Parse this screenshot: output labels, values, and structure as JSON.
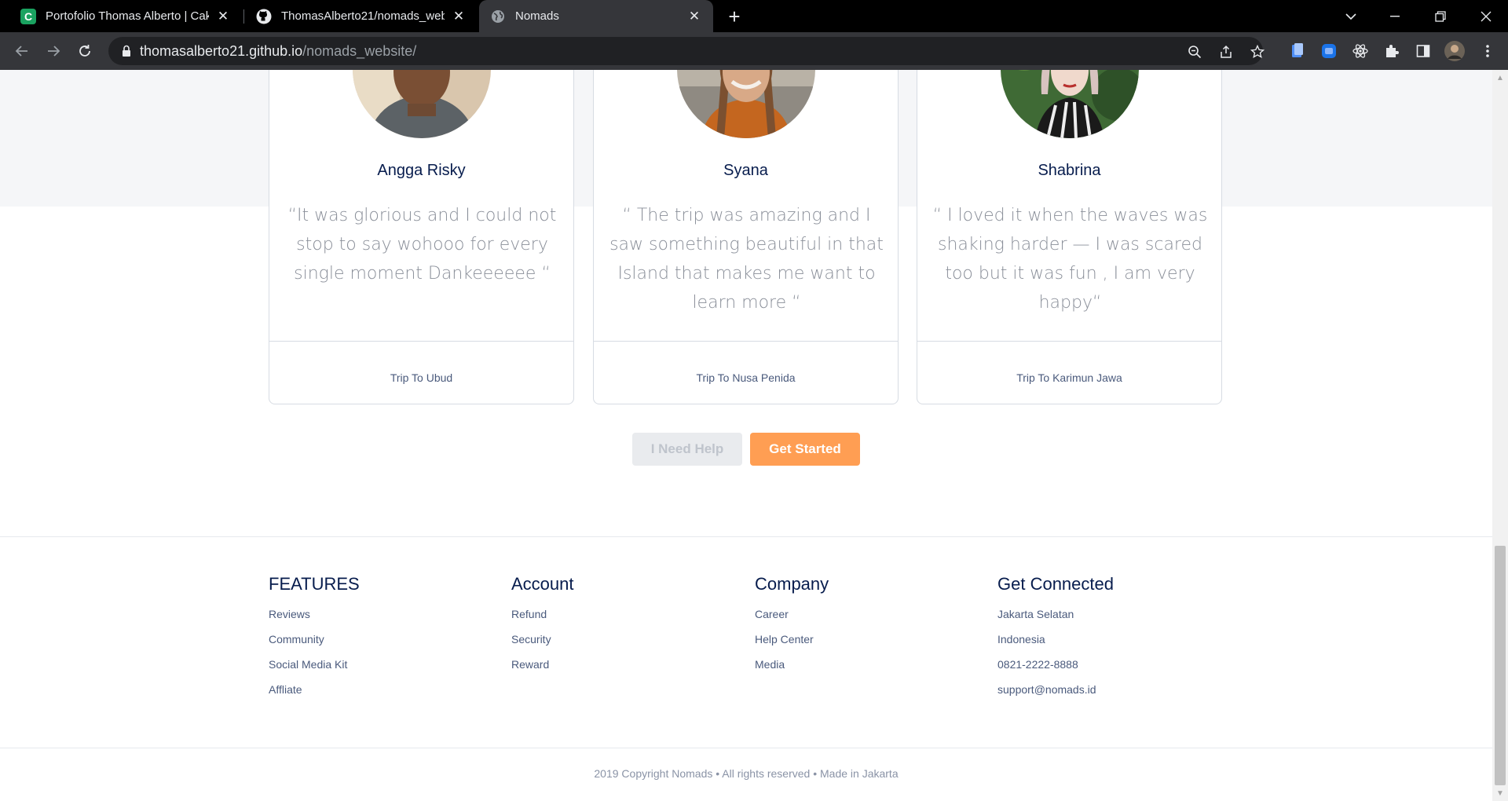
{
  "browser": {
    "tabs": [
      {
        "title": "Portofolio Thomas Alberto | Cake",
        "favicon": "cake-c-icon",
        "active": false
      },
      {
        "title": "ThomasAlberto21/nomads_webs",
        "favicon": "github-icon",
        "active": false
      },
      {
        "title": "Nomads",
        "favicon": "globe-icon",
        "active": true
      }
    ],
    "url_host": "thomasalberto21.github.io",
    "url_path": "/nomads_website/"
  },
  "testimonials": [
    {
      "name": "Angga Risky",
      "quote": "“It was glorious and I could not stop to say wohooo for every single moment Dankeeeeee “",
      "trip": "Trip To Ubud"
    },
    {
      "name": "Syana",
      "quote": "“ The trip was amazing and I saw something beautiful in that Island that makes me want to learn more “",
      "trip": "Trip To Nusa Penida"
    },
    {
      "name": "Shabrina",
      "quote": "“ I loved it when the waves was shaking harder — I was scared too but it was fun , I am very happy“",
      "trip": "Trip To Karimun Jawa"
    }
  ],
  "actions": {
    "help_label": "I Need Help",
    "start_label": "Get Started"
  },
  "footer": {
    "columns": [
      {
        "heading": "FEATURES",
        "links": [
          "Reviews",
          "Community",
          "Social Media Kit",
          "Affliate"
        ]
      },
      {
        "heading": "Account",
        "links": [
          "Refund",
          "Security",
          "Reward"
        ]
      },
      {
        "heading": "Company",
        "links": [
          "Career",
          "Help Center",
          "Media"
        ]
      },
      {
        "heading": "Get Connected",
        "links": [
          "Jakarta Selatan",
          "Indonesia",
          "0821-2222-8888",
          "support@nomads.id"
        ]
      }
    ],
    "copyright": "2019 Copyright Nomads • All rights reserved • Made in Jakarta"
  },
  "colors": {
    "accent": "#ff9e53",
    "navy": "#071c4d",
    "muted_text": "#8a8f99"
  }
}
